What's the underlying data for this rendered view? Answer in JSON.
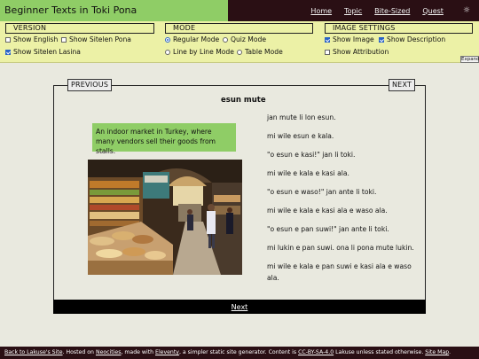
{
  "site": {
    "title": "Beginner Texts in Toki Pona"
  },
  "nav": {
    "home": "Home",
    "topic": "Topic",
    "bite_sized": "Bite-Sized",
    "quest": "Quest",
    "theme_icon": "sun-icon"
  },
  "settings": {
    "version": {
      "heading": "VERSION",
      "show_english": "Show English",
      "show_sitelen_pona": "Show Sitelen Pona",
      "show_sitelen_lasina": "Show Sitelen Lasina"
    },
    "mode": {
      "heading": "MODE",
      "regular": "Regular Mode",
      "quiz": "Quiz Mode",
      "line_by_line": "Line by Line Mode",
      "table": "Table Mode"
    },
    "image": {
      "heading": "IMAGE SETTINGS",
      "show_image": "Show Image",
      "show_description": "Show Description",
      "show_attribution": "Show Attribution"
    },
    "expand_label": "Expand"
  },
  "story": {
    "previous_label": "PREVIOUS",
    "next_label_top": "NEXT",
    "title": "esun mute",
    "description": "An indoor market in Turkey, where many vendors sell their goods from stalls.",
    "lines": [
      "jan mute li lon esun.",
      "mi wile esun e kala.",
      "\"o esun e kasi!\" jan li toki.",
      "mi wile e kala e kasi ala.",
      "\"o esun e waso!\" jan ante li toki.",
      "mi wile e kala e kasi ala e waso ala.",
      "\"o esun e pan suwi!\" jan ante li toki.",
      "mi lukin e pan suwi. ona li pona mute lukin.",
      "mi wile e kala e pan suwi e kasi ala e waso ala."
    ],
    "next_link": "Next"
  },
  "footer": {
    "back_link": "Back to Lakuse's Site",
    "hosted_text": ". Hosted on ",
    "neocities": "Neocities",
    "made_with": ", made with ",
    "eleventy": "Eleventy",
    "generator_text": ", a simpler static site generator. Content is ",
    "license": "CC-BY-SA-4.0",
    "owner_text": " Lakuse unless stated otherwise. ",
    "site_map": "Site Map",
    "end": "."
  }
}
